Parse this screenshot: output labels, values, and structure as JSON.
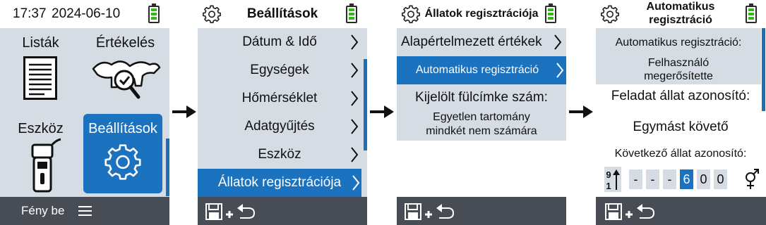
{
  "colors": {
    "accent": "#1b72bf",
    "panel": "#d5dce3",
    "footer": "#474c55",
    "battery": "#38b41d"
  },
  "screen1": {
    "time": "17:37",
    "date": "2024-06-10",
    "tiles": [
      {
        "label": "Listák",
        "icon": "document-list-icon"
      },
      {
        "label": "Értékelés",
        "icon": "cattle-magnifier-icon"
      },
      {
        "label": "Eszköz",
        "icon": "handheld-reader-icon"
      },
      {
        "label": "Beállítások",
        "icon": "gear-icon"
      }
    ],
    "footer_left": "Fény be",
    "footer_menu_icon": "menu-icon"
  },
  "screen2": {
    "title": "Beállítások",
    "items": [
      {
        "label": "Dátum & Idő"
      },
      {
        "label": "Egységek"
      },
      {
        "label": "Hőmérséklet"
      },
      {
        "label": "Adatgyűjtés"
      },
      {
        "label": "Eszköz"
      },
      {
        "label": "Állatok regisztrációja"
      }
    ],
    "footer_icon": "save-and-back-icon"
  },
  "screen3": {
    "title": "Állatok regisztrációja",
    "items": [
      {
        "label": "Alapértelmezett értékek"
      },
      {
        "label": "Automatikus regisztráció"
      },
      {
        "label": "Kijelölt fülcímke szám:"
      }
    ],
    "sub_value_line1": "Egyetlen tartomány",
    "sub_value_line2": "mindkét nem számára",
    "footer_icon": "save-and-back-icon"
  },
  "screen4": {
    "title_line1": "Automatikus",
    "title_line2": "regisztráció",
    "auto_label": "Automatikus regisztráció:",
    "auto_value_line1": "Felhasználó",
    "auto_value_line2": "megerősítette",
    "task_label": "Feladat állat azonosító:",
    "task_value": "Egymást követő",
    "next_label": "Következő állat azonosító:",
    "sort_icon": "sort-9-1-icon",
    "digits": [
      "-",
      "-",
      "-",
      "6",
      "0",
      "0"
    ],
    "gender_icon": "gender-symbol-icon",
    "footer_icon": "save-and-back-icon"
  }
}
